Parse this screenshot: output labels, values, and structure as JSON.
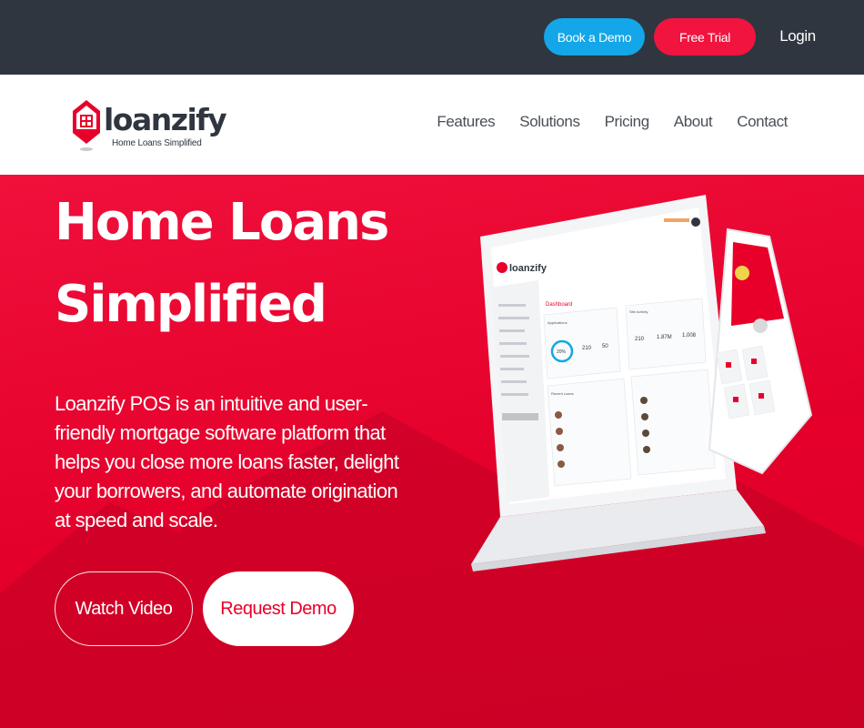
{
  "topbar": {
    "book_demo": "Book a Demo",
    "free_trial": "Free Trial",
    "login": "Login"
  },
  "logo": {
    "name": "loanzify",
    "tagline": "Home Loans Simplified"
  },
  "nav": {
    "items": [
      "Features",
      "Solutions",
      "Pricing",
      "About",
      "Contact"
    ]
  },
  "hero": {
    "title_line1": "Home Loans",
    "title_line2": "Simplified",
    "body": "Loanzify POS is an intuitive and user-friendly mortgage software platform that helps you close more loans faster, delight your borrowers, and automate origination at speed and scale.",
    "watch_video": "Watch Video",
    "request_demo": "Request Demo"
  },
  "mockup": {
    "brand": "loanzify",
    "dashboard": "Dashboard",
    "applications": "Applications",
    "site_activity": "Site Activity",
    "recent_loans": "Recent Loans",
    "stat_pct": "20%",
    "stat_a": "210",
    "stat_b": "50",
    "stat_c": "210",
    "stat_d": "1.87M",
    "stat_e": "1,008"
  },
  "colors": {
    "accent": "#e8002a",
    "topbar": "#2f3640",
    "demo_blue": "#13a6e8"
  }
}
